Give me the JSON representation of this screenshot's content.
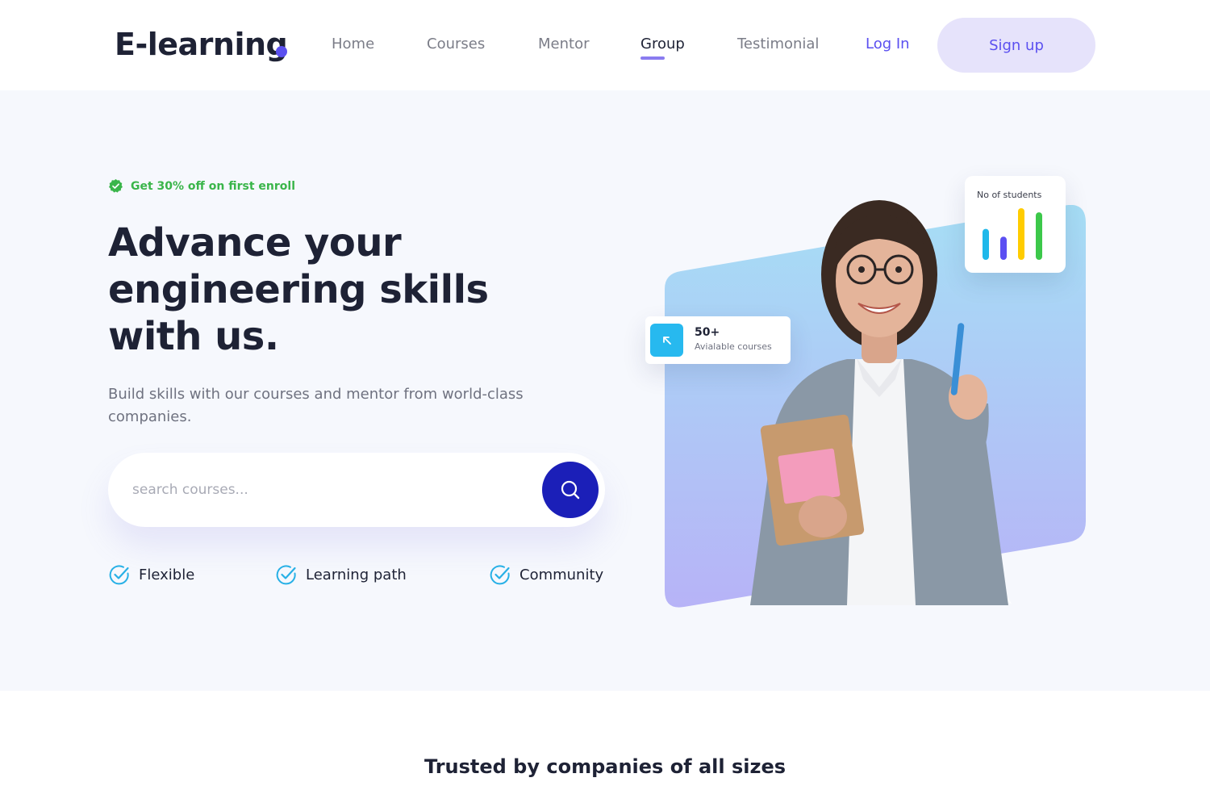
{
  "brand": {
    "name": "E-learning",
    "accent_color": "#5b50f0"
  },
  "nav": {
    "items": [
      {
        "label": "Home"
      },
      {
        "label": "Courses"
      },
      {
        "label": "Mentor"
      },
      {
        "label": "Group",
        "active": true
      },
      {
        "label": "Testimonial"
      }
    ],
    "login_label": "Log In",
    "signup_label": "Sign up"
  },
  "hero": {
    "promo": {
      "text": "Get 30% off on first enroll",
      "icon": "check-badge-icon",
      "color": "#3ab54a"
    },
    "headline": "Advance your engineering skills with us.",
    "subtext": "Build skills with our courses and mentor from world-class companies.",
    "search": {
      "placeholder": "search courses...",
      "value": "",
      "icon": "search-icon"
    },
    "features": [
      {
        "label": "Flexible",
        "icon": "check-circle-icon"
      },
      {
        "label": "Learning path",
        "icon": "check-circle-icon"
      },
      {
        "label": "Community",
        "icon": "check-circle-icon"
      }
    ],
    "courses_card": {
      "count": "50+",
      "label": "Avialable courses",
      "icon": "arrow-up-left-icon"
    },
    "students_card": {
      "title": "No of students",
      "bars": [
        {
          "level": 0.6,
          "color": "#1fb8ea"
        },
        {
          "level": 0.45,
          "color": "#5b4ff2"
        },
        {
          "level": 1.0,
          "color": "#ffcc00"
        },
        {
          "level": 0.92,
          "color": "#3cc84a"
        }
      ]
    }
  },
  "trusted": {
    "heading": "Trusted by companies of all sizes"
  }
}
